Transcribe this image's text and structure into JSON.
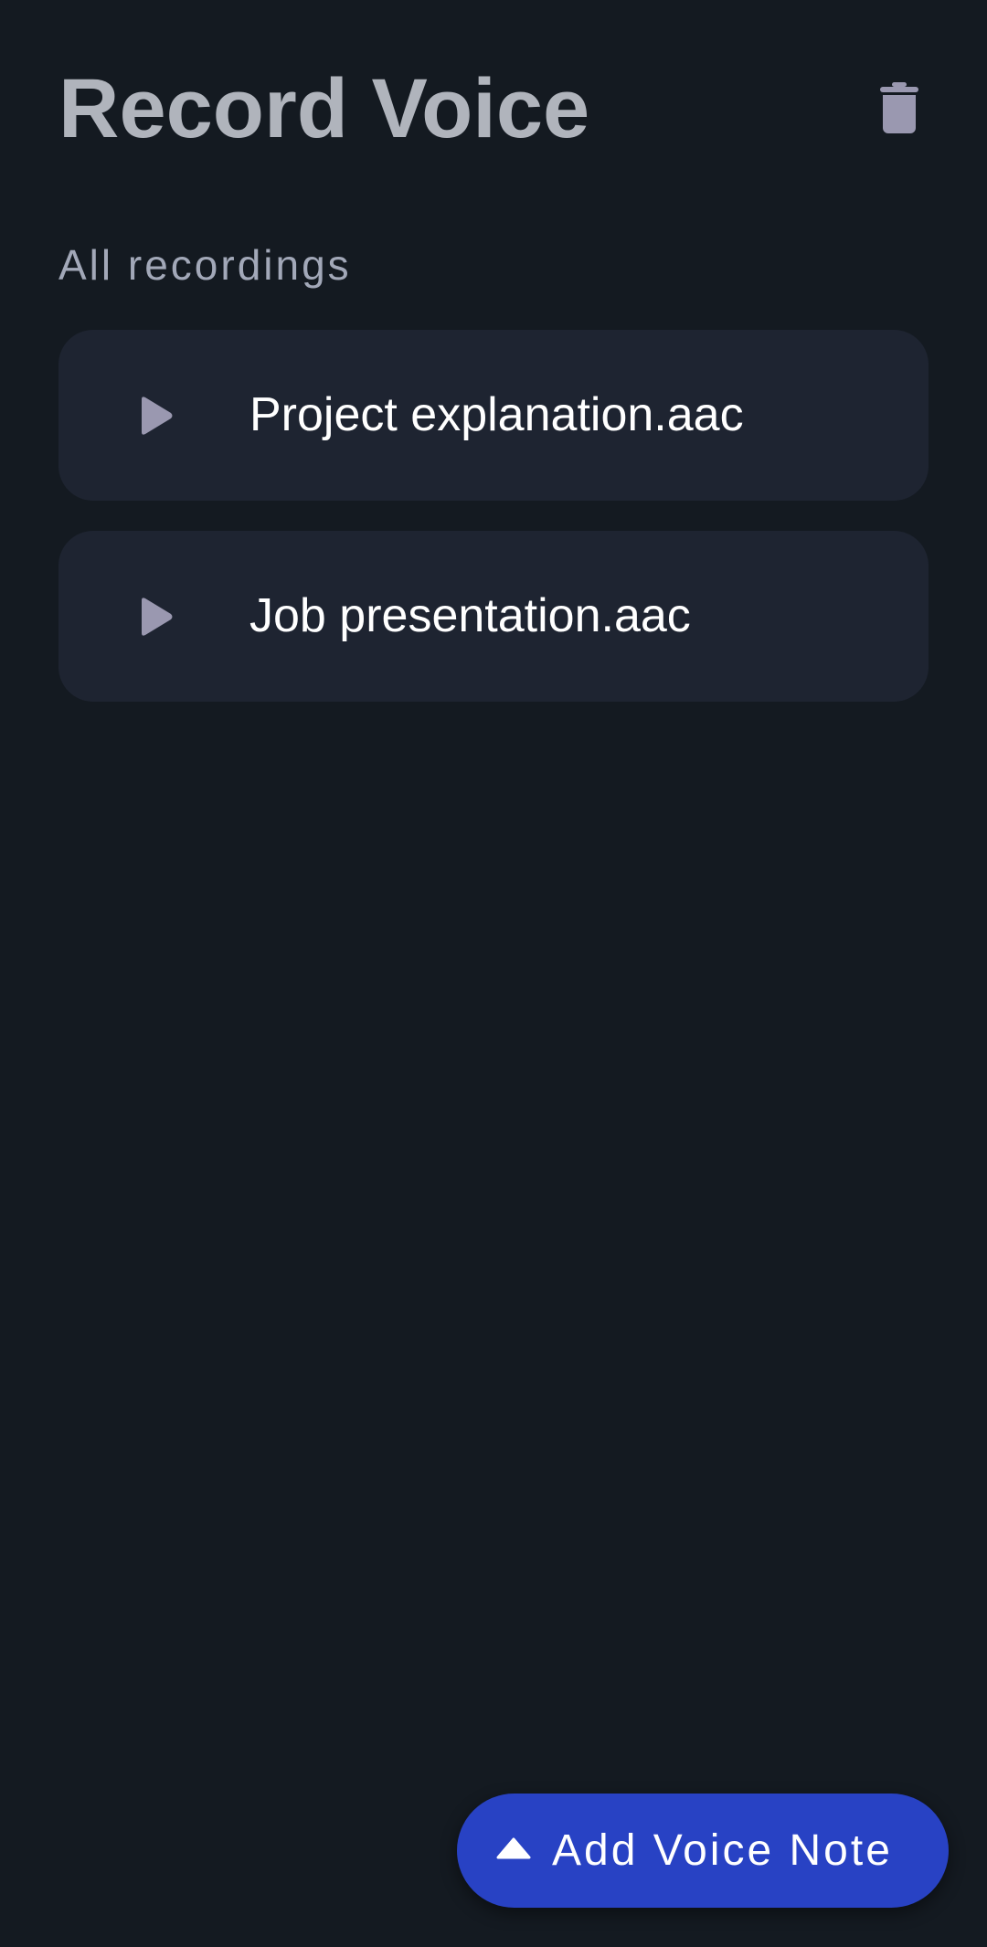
{
  "header": {
    "title": "Record Voice",
    "delete_icon": "trash-icon"
  },
  "section": {
    "label": "All recordings"
  },
  "recordings": [
    {
      "name": "Project explanation.aac",
      "icon": "play-icon"
    },
    {
      "name": "Job presentation.aac",
      "icon": "play-icon"
    }
  ],
  "fab": {
    "label": "Add Voice Note",
    "icon": "caret-up-icon"
  },
  "colors": {
    "background": "#141a21",
    "card": "#1e2431",
    "accent": "#2842c4",
    "icon": "#9a98b0",
    "title": "#b0b4bc"
  }
}
